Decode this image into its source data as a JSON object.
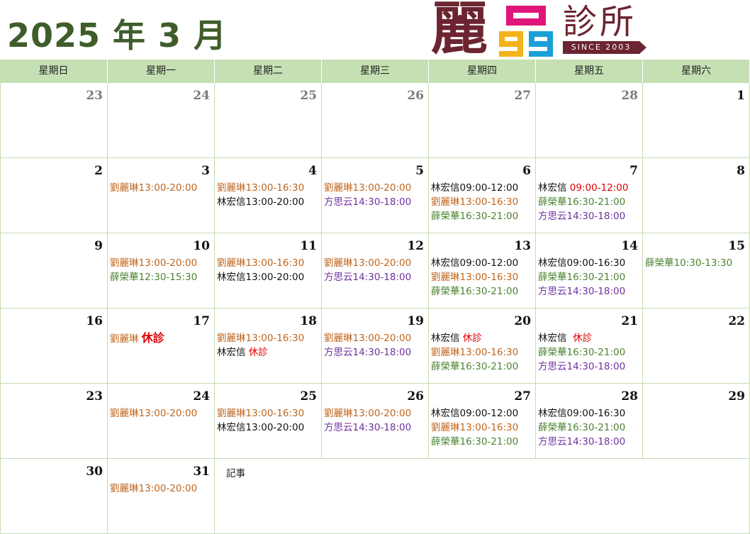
{
  "title": "2025 年 3 月",
  "logo": {
    "char": "麗",
    "clinic": "診所",
    "since": "SINCE 2003"
  },
  "weekdays": [
    "星期日",
    "星期一",
    "星期二",
    "星期三",
    "星期四",
    "星期五",
    "星期六"
  ],
  "notes_label": "記事",
  "colors": {
    "header_bg": "#c5e0b3",
    "title": "#3f5d2a",
    "liu": "#c0651c",
    "lin": "#111111",
    "xue": "#4b8431",
    "fang": "#7030a0",
    "off": "#e00000"
  },
  "weeks": [
    [
      {
        "day": "23",
        "dim": true,
        "entries": []
      },
      {
        "day": "24",
        "dim": true,
        "entries": []
      },
      {
        "day": "25",
        "dim": true,
        "entries": []
      },
      {
        "day": "26",
        "dim": true,
        "entries": []
      },
      {
        "day": "27",
        "dim": true,
        "entries": []
      },
      {
        "day": "28",
        "dim": true,
        "entries": []
      },
      {
        "day": "1",
        "entries": []
      }
    ],
    [
      {
        "day": "2",
        "entries": []
      },
      {
        "day": "3",
        "entries": [
          {
            "name": "劉麗琳",
            "time": "13:00-20:00",
            "c": "orange"
          }
        ]
      },
      {
        "day": "4",
        "entries": [
          {
            "name": "劉麗琳",
            "time": "13:00-16:30",
            "c": "orange"
          },
          {
            "name": "林宏信",
            "time": "13:00-20:00",
            "c": "black"
          }
        ]
      },
      {
        "day": "5",
        "entries": [
          {
            "name": "劉麗琳",
            "time": "13:00-20:00",
            "c": "orange"
          },
          {
            "name": "方思云",
            "time": "14:30-18:00",
            "c": "purple"
          }
        ]
      },
      {
        "day": "6",
        "entries": [
          {
            "name": "林宏信",
            "time": "09:00-12:00",
            "c": "black"
          },
          {
            "name": "劉麗琳",
            "time": "13:00-16:30",
            "c": "orange"
          },
          {
            "name": "薛榮華",
            "time": "16:30-21:00",
            "c": "green"
          }
        ]
      },
      {
        "day": "7",
        "entries": [
          {
            "name": "林宏信 ",
            "time": "09:00-12:00",
            "c": "black",
            "redtime": true
          },
          {
            "name": "薛榮華",
            "time": "16:30-21:00",
            "c": "green"
          },
          {
            "name": "方思云",
            "time": "14:30-18:00",
            "c": "purple"
          }
        ]
      },
      {
        "day": "8",
        "entries": []
      }
    ],
    [
      {
        "day": "9",
        "entries": []
      },
      {
        "day": "10",
        "entries": [
          {
            "name": "劉麗琳",
            "time": "13:00-20:00",
            "c": "orange"
          },
          {
            "name": "薛榮華",
            "time": "12:30-15:30",
            "c": "green"
          }
        ]
      },
      {
        "day": "11",
        "entries": [
          {
            "name": "劉麗琳",
            "time": "13:00-16:30",
            "c": "orange"
          },
          {
            "name": "林宏信",
            "time": "13:00-20:00",
            "c": "black"
          }
        ]
      },
      {
        "day": "12",
        "entries": [
          {
            "name": "劉麗琳",
            "time": "13:00-20:00",
            "c": "orange"
          },
          {
            "name": "方思云",
            "time": "14:30-18:00",
            "c": "purple"
          }
        ]
      },
      {
        "day": "13",
        "entries": [
          {
            "name": "林宏信",
            "time": "09:00-12:00",
            "c": "black"
          },
          {
            "name": "劉麗琳",
            "time": "13:00-16:30",
            "c": "orange"
          },
          {
            "name": "薛榮華",
            "time": "16:30-21:00",
            "c": "green"
          }
        ]
      },
      {
        "day": "14",
        "entries": [
          {
            "name": "林宏信",
            "time": "09:00-16:30",
            "c": "black"
          },
          {
            "name": "薛榮華",
            "time": "16:30-21:00",
            "c": "green"
          },
          {
            "name": "方思云",
            "time": "14:30-18:00",
            "c": "purple"
          }
        ]
      },
      {
        "day": "15",
        "entries": [
          {
            "name": "薛榮華",
            "time": "10:30-13:30",
            "c": "green"
          }
        ]
      }
    ],
    [
      {
        "day": "16",
        "entries": []
      },
      {
        "day": "17",
        "entries": [
          {
            "name": "劉麗琳 ",
            "off": "休診",
            "c": "orange",
            "big": true
          }
        ]
      },
      {
        "day": "18",
        "entries": [
          {
            "name": "劉麗琳",
            "time": "13:00-16:30",
            "c": "orange"
          },
          {
            "name": "林宏信 ",
            "off": "休診",
            "c": "black"
          }
        ]
      },
      {
        "day": "19",
        "entries": [
          {
            "name": "劉麗琳",
            "time": "13:00-20:00",
            "c": "orange"
          },
          {
            "name": "方思云",
            "time": "14:30-18:00",
            "c": "purple"
          }
        ]
      },
      {
        "day": "20",
        "entries": [
          {
            "name": "林宏信 ",
            "off": "休診",
            "c": "black"
          },
          {
            "name": "劉麗琳",
            "time": "13:00-16:30",
            "c": "orange"
          },
          {
            "name": "薛榮華",
            "time": "16:30-21:00",
            "c": "green"
          }
        ]
      },
      {
        "day": "21",
        "entries": [
          {
            "name": "林宏信  ",
            "off": "休診",
            "c": "black"
          },
          {
            "name": "薛榮華",
            "time": "16:30-21:00",
            "c": "green"
          },
          {
            "name": "方思云",
            "time": "14:30-18:00",
            "c": "purple"
          }
        ]
      },
      {
        "day": "22",
        "entries": []
      }
    ],
    [
      {
        "day": "23",
        "entries": []
      },
      {
        "day": "24",
        "entries": [
          {
            "name": "劉麗琳",
            "time": "13:00-20:00",
            "c": "orange"
          }
        ]
      },
      {
        "day": "25",
        "entries": [
          {
            "name": "劉麗琳",
            "time": "13:00-16:30",
            "c": "orange"
          },
          {
            "name": "林宏信",
            "time": "13:00-20:00",
            "c": "black"
          }
        ]
      },
      {
        "day": "26",
        "entries": [
          {
            "name": "劉麗琳",
            "time": "13:00-20:00",
            "c": "orange"
          },
          {
            "name": "方思云",
            "time": "14:30-18:00",
            "c": "purple"
          }
        ]
      },
      {
        "day": "27",
        "entries": [
          {
            "name": "林宏信",
            "time": "09:00-12:00",
            "c": "black"
          },
          {
            "name": "劉麗琳",
            "time": "13:00-16:30",
            "c": "orange"
          },
          {
            "name": "薛榮華",
            "time": "16:30-21:00",
            "c": "green"
          }
        ]
      },
      {
        "day": "28",
        "entries": [
          {
            "name": "林宏信",
            "time": "09:00-16:30",
            "c": "black"
          },
          {
            "name": "薛榮華",
            "time": "16:30-21:00",
            "c": "green"
          },
          {
            "name": "方思云",
            "time": "14:30-18:00",
            "c": "purple"
          }
        ]
      },
      {
        "day": "29",
        "entries": []
      }
    ],
    [
      {
        "day": "30",
        "entries": []
      },
      {
        "day": "31",
        "entries": [
          {
            "name": "劉麗琳",
            "time": "13:00-20:00",
            "c": "orange"
          }
        ]
      }
    ]
  ]
}
